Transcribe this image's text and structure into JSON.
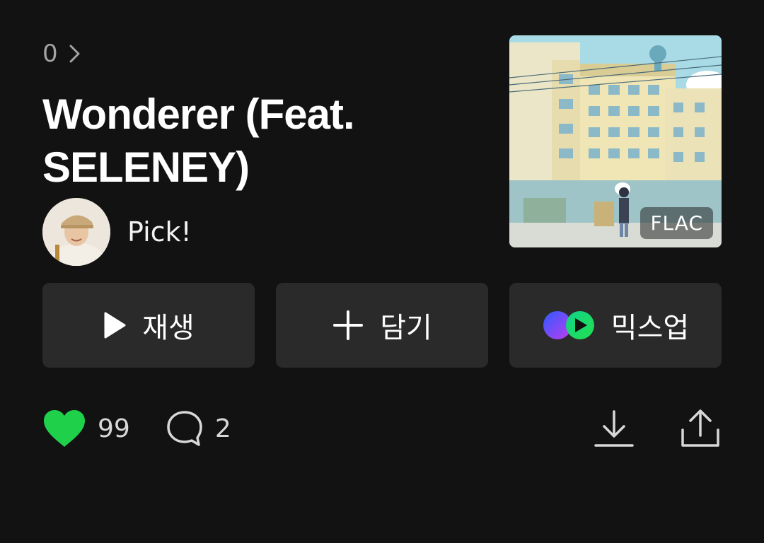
{
  "breadcrumb": {
    "text": "0"
  },
  "song": {
    "title": "Wonderer (Feat. SELENEY)"
  },
  "artist": {
    "name": "Pick!"
  },
  "cover": {
    "badge": "FLAC"
  },
  "actions": [
    {
      "label": "재생",
      "icon": "play-icon"
    },
    {
      "label": "담기",
      "icon": "plus-icon"
    },
    {
      "label": "믹스업",
      "icon": "mixup-icon"
    }
  ],
  "stats": {
    "likes": "99",
    "comments": "2"
  },
  "colors": {
    "background": "#121212",
    "button_bg": "#2a2a2a",
    "like": "#1fd04a"
  }
}
